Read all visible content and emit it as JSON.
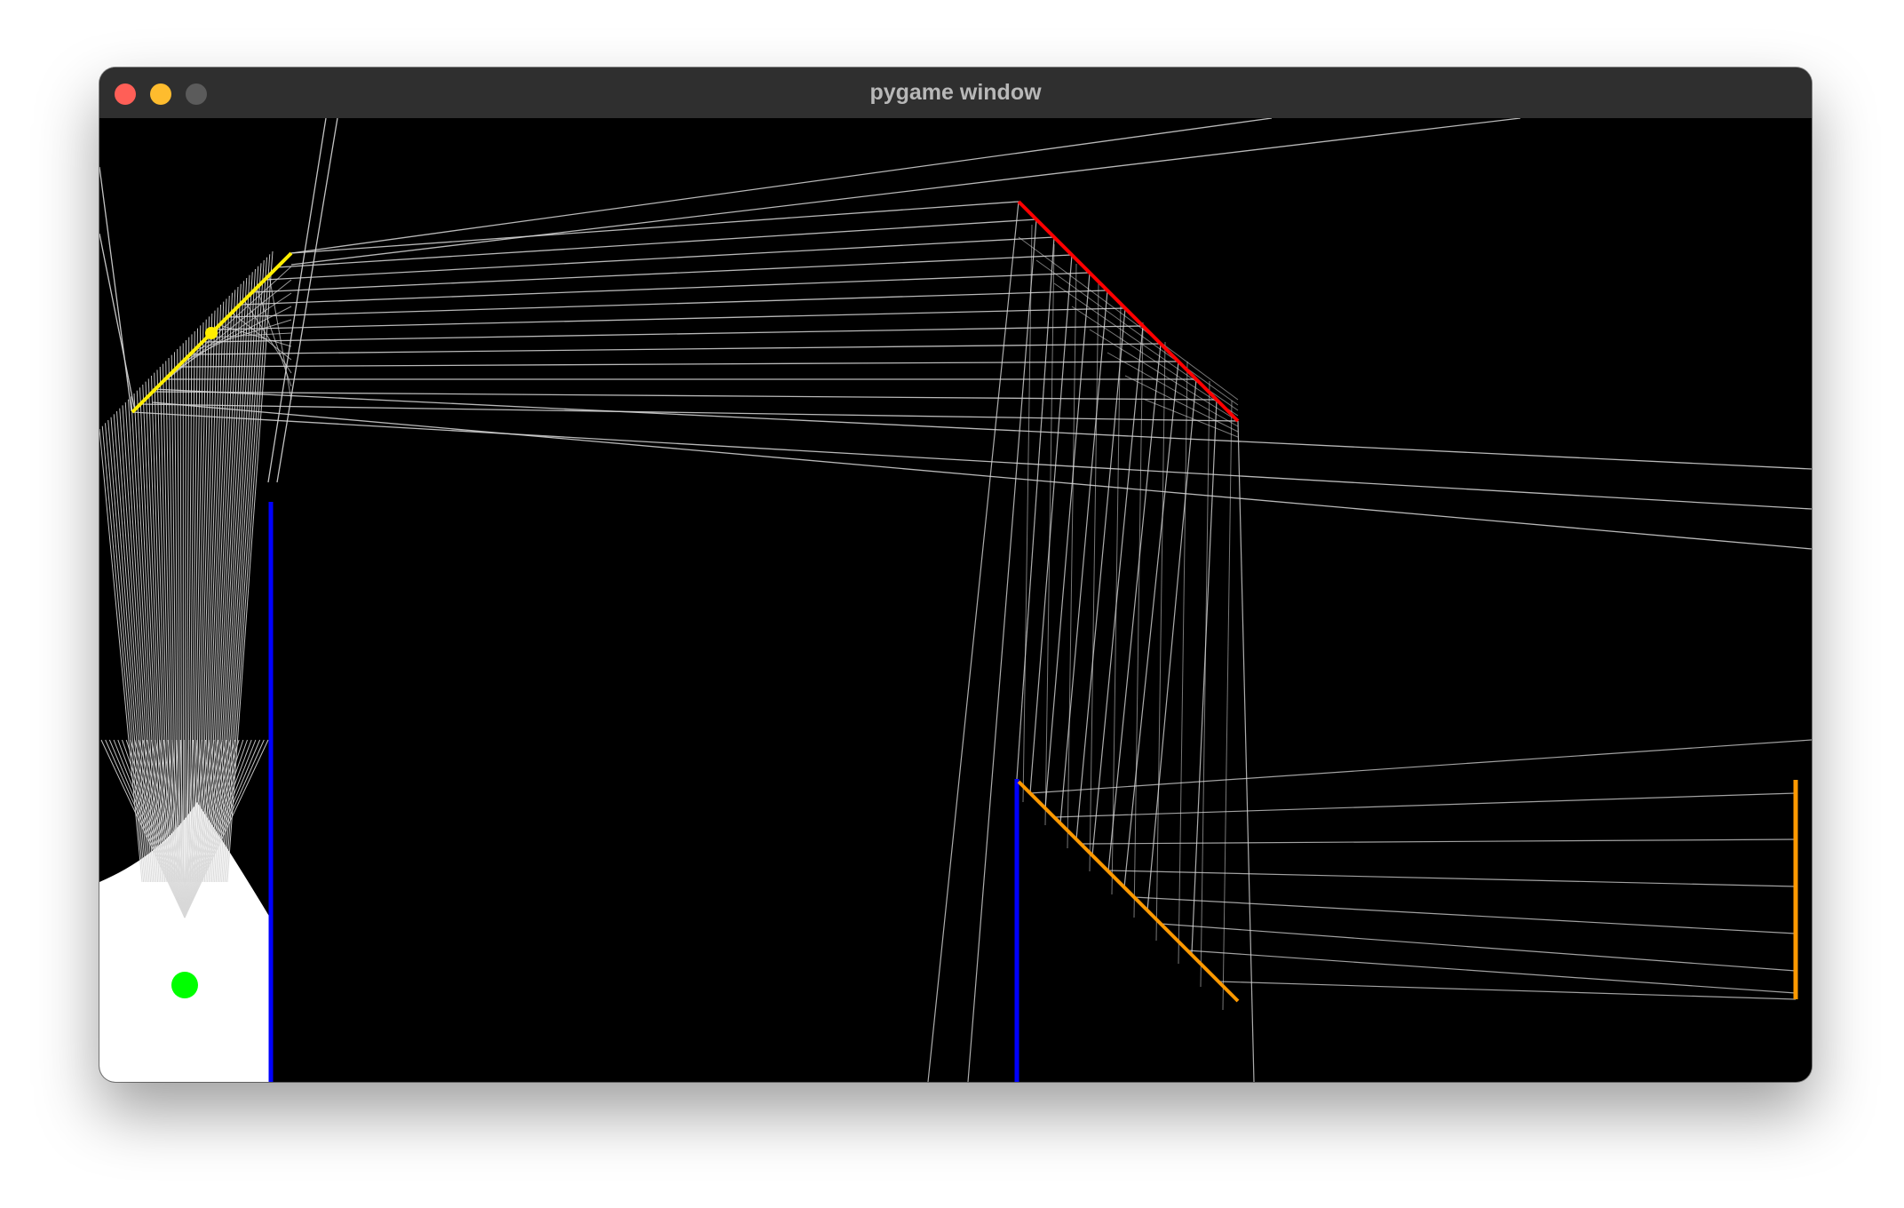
{
  "window": {
    "title": "pygame window",
    "buttons": [
      "close",
      "minimize",
      "zoom"
    ]
  },
  "scene": {
    "background_color": "#000000",
    "ray_color": "#d8d8d8",
    "light_source": {
      "color": "#00ff00",
      "icon": "light-source-dot"
    },
    "mirrors": [
      {
        "name": "yellow-mirror",
        "color": "#ffee00",
        "has_handle": true
      },
      {
        "name": "red-mirror",
        "color": "#ff0000"
      },
      {
        "name": "orange-diagonal-mirror",
        "color": "#ff9900"
      },
      {
        "name": "orange-vertical-mirror",
        "color": "#ff9900"
      }
    ],
    "walls": [
      {
        "name": "blue-wall-left",
        "color": "#0000ff"
      },
      {
        "name": "blue-wall-center",
        "color": "#0000ff"
      }
    ]
  }
}
